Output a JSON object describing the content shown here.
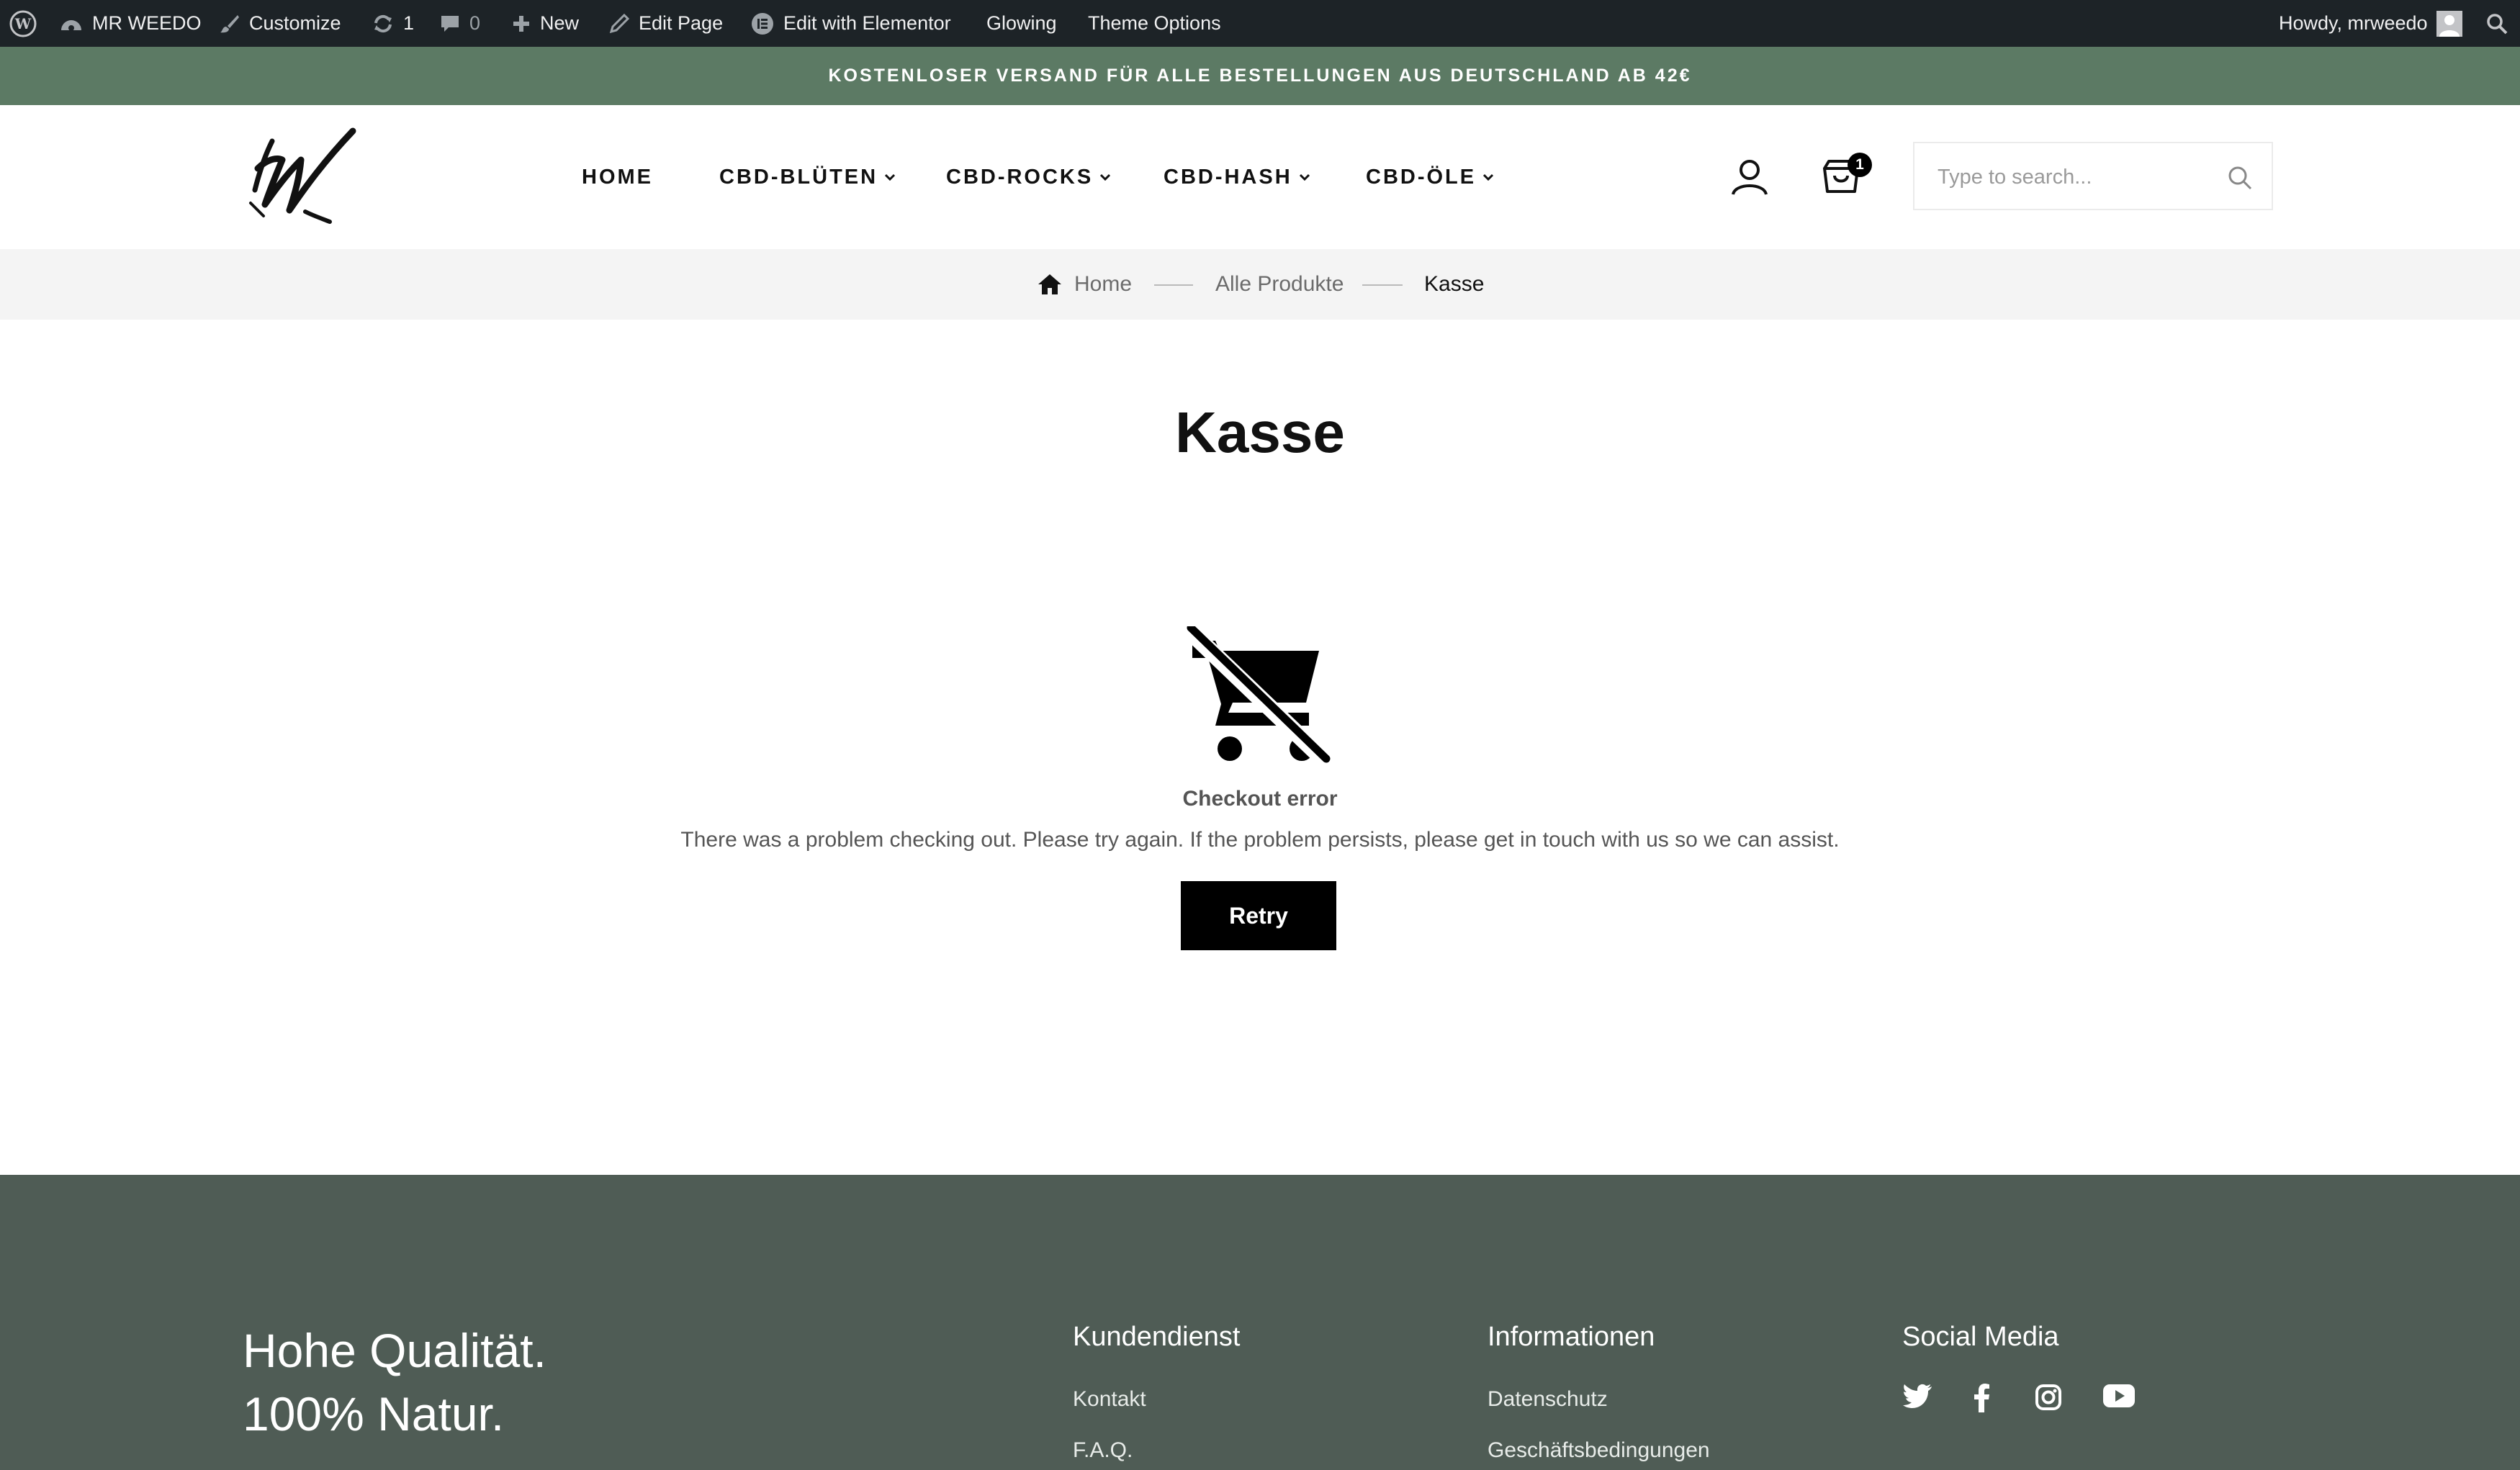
{
  "adminbar": {
    "site_name": "MR WEEDO",
    "customize": "Customize",
    "updates_count": "1",
    "comments_count": "0",
    "new_label": "New",
    "edit_page": "Edit Page",
    "edit_elementor": "Edit with Elementor",
    "glowing": "Glowing",
    "theme_options": "Theme Options",
    "howdy": "Howdy, mrweedo"
  },
  "promo": {
    "text": "KOSTENLOSER VERSAND FÜR ALLE BESTELLUNGEN AUS DEUTSCHLAND AB 42€"
  },
  "header": {
    "nav": [
      "HOME",
      "CBD-BLÜTEN",
      "CBD-ROCKS",
      "CBD-HASH",
      "CBD-ÖLE"
    ],
    "cart_count": "1",
    "search_placeholder": "Type to search..."
  },
  "breadcrumb": {
    "items": [
      "Home",
      "Alle Produkte",
      "Kasse"
    ]
  },
  "main": {
    "title": "Kasse",
    "error_title": "Checkout error",
    "error_text": "There was a problem checking out. Please try again. If the problem persists, please get in touch with us so we can assist.",
    "retry_label": "Retry"
  },
  "footer": {
    "tagline_line1": "Hohe Qualität.",
    "tagline_line2": "100% Natur.",
    "col1": {
      "heading": "Kundendienst",
      "links": [
        "Kontakt",
        "F.A.Q."
      ]
    },
    "col2": {
      "heading": "Informationen",
      "links": [
        "Datenschutz",
        "Geschäftsbedingungen"
      ]
    },
    "col3": {
      "heading": "Social Media",
      "icons": [
        "twitter-icon",
        "facebook-icon",
        "instagram-icon",
        "youtube-icon"
      ]
    }
  },
  "colors": {
    "adminbar_bg": "#1d2327",
    "promo_bg": "#5c7a64",
    "footer_bg": "#4f5c55",
    "button_bg": "#000000"
  }
}
